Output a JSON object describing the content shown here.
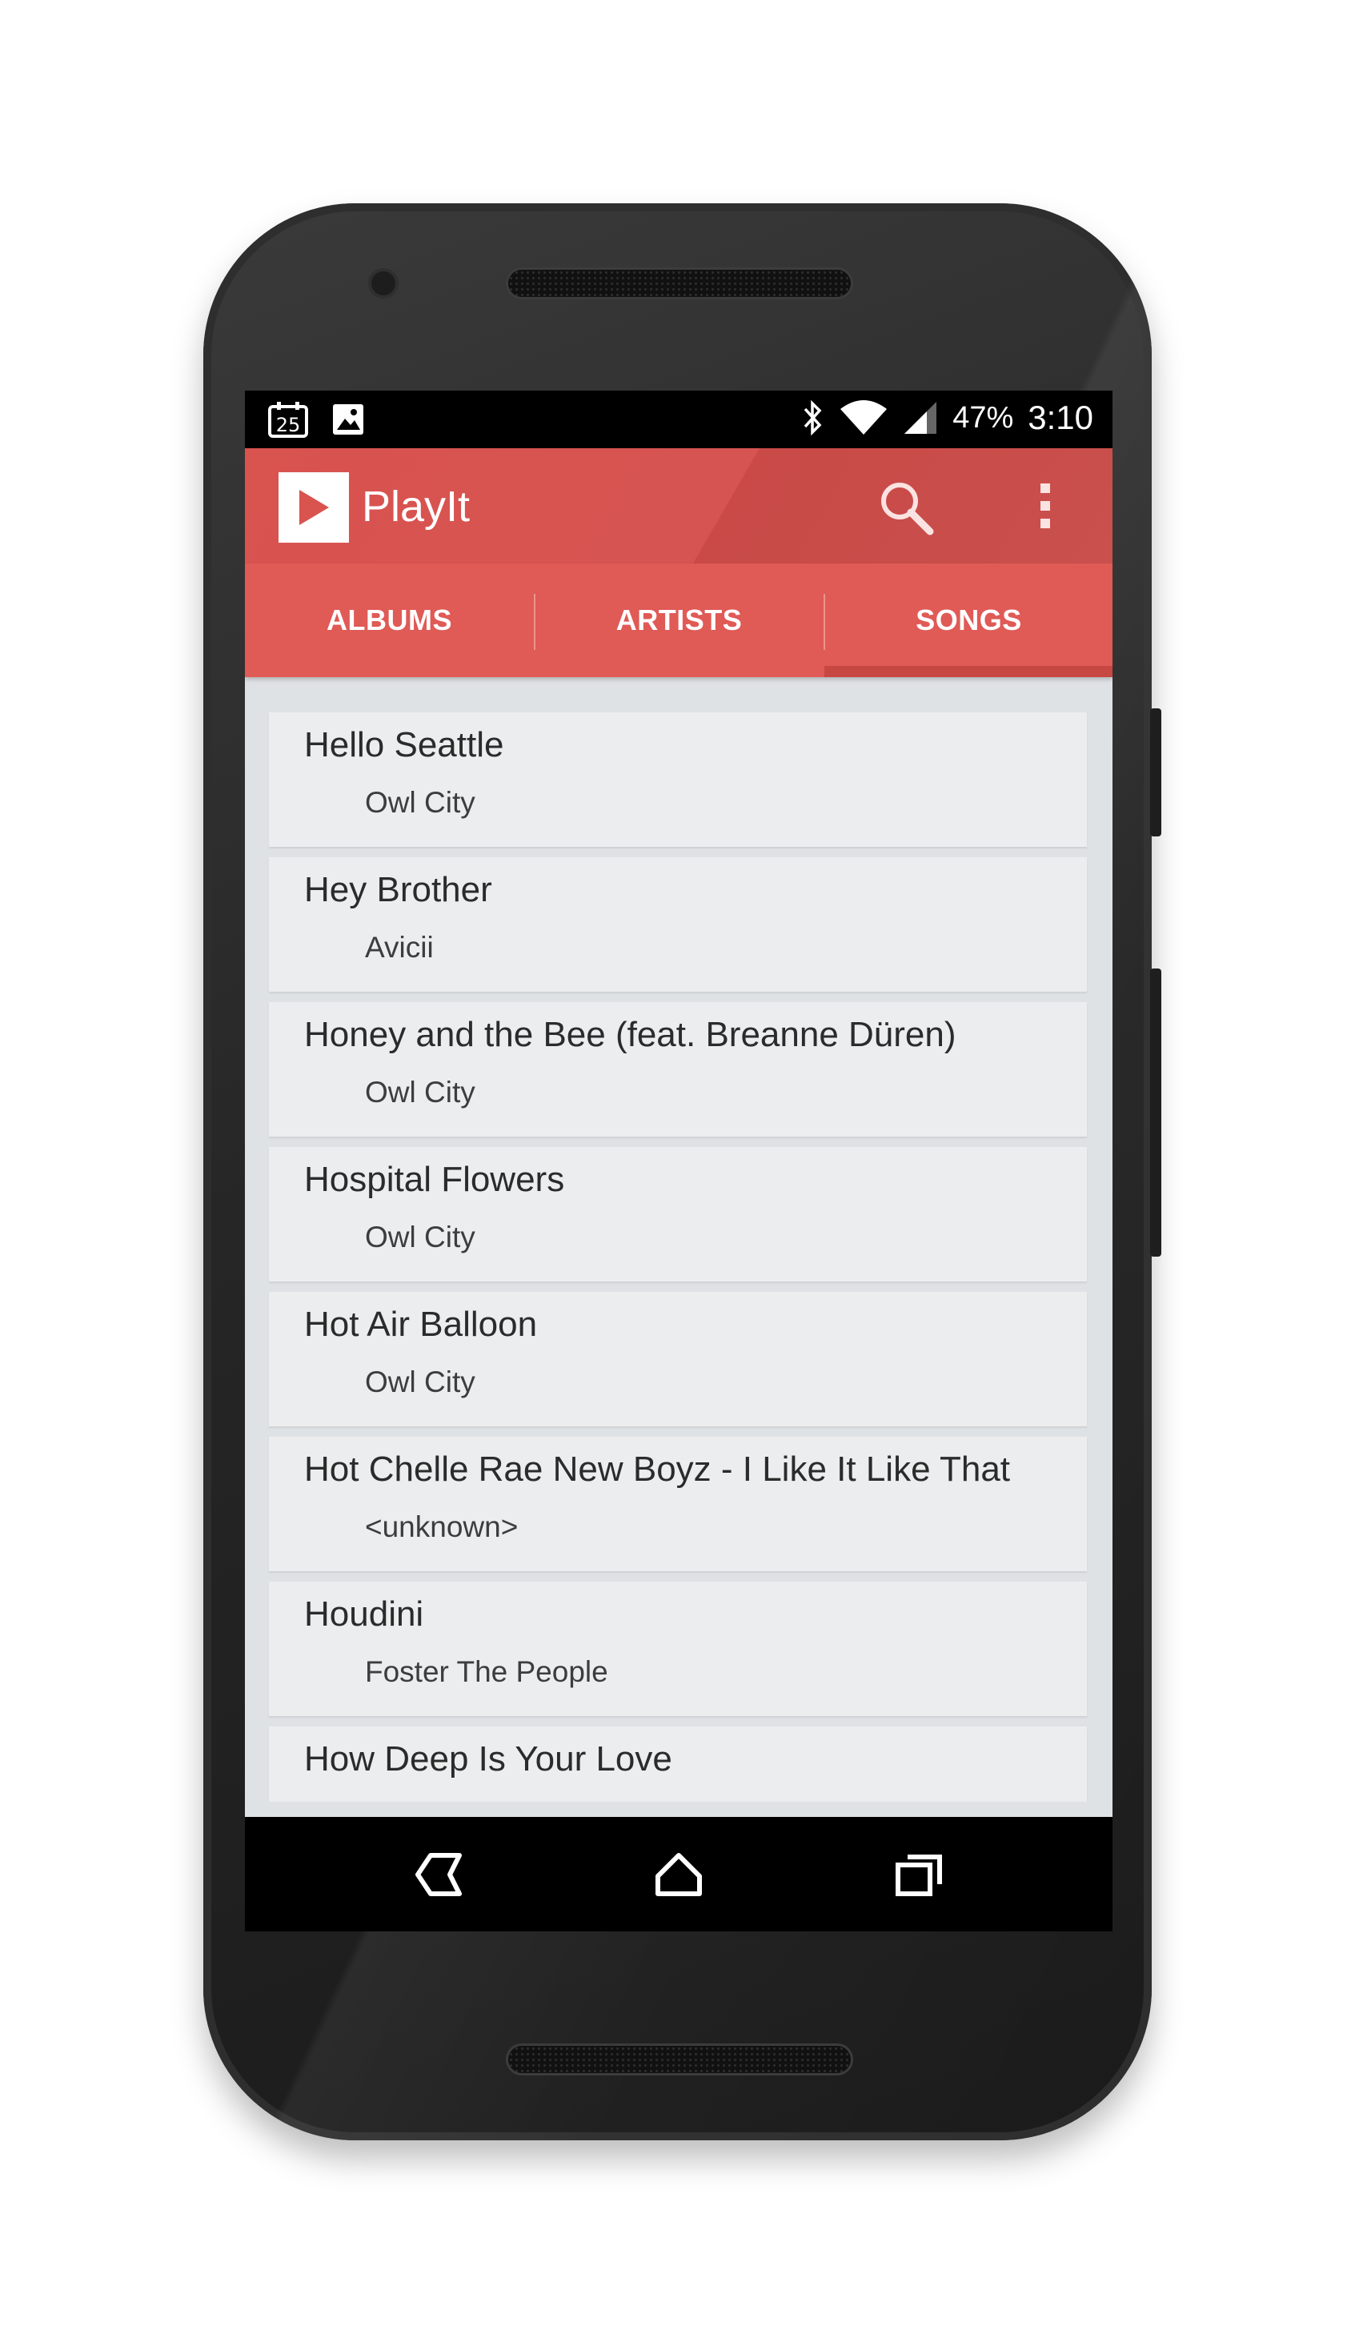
{
  "status_bar": {
    "calendar_day": "25",
    "battery": "47%",
    "time": "3:10",
    "icons": [
      "calendar-icon",
      "image-icon",
      "bluetooth-icon",
      "wifi-icon",
      "signal-icon"
    ]
  },
  "app_bar": {
    "title": "PlayIt",
    "logo_icon": "play-icon",
    "actions": [
      "search-icon",
      "more-vert-icon"
    ],
    "color": "#d9534f"
  },
  "tabs": [
    {
      "label": "ALBUMS",
      "selected": false
    },
    {
      "label": "ARTISTS",
      "selected": false
    },
    {
      "label": "SONGS",
      "selected": true
    }
  ],
  "songs": [
    {
      "title": "Hello Seattle",
      "artist": "Owl City"
    },
    {
      "title": "Hey Brother",
      "artist": "Avicii"
    },
    {
      "title": "Honey and the Bee (feat. Breanne Düren)",
      "artist": "Owl City"
    },
    {
      "title": "Hospital Flowers",
      "artist": "Owl City"
    },
    {
      "title": "Hot Air Balloon",
      "artist": "Owl City"
    },
    {
      "title": "Hot Chelle Rae New Boyz - I Like It Like That",
      "artist": "<unknown>"
    },
    {
      "title": "Houdini",
      "artist": "Foster The People"
    },
    {
      "title": "How Deep Is Your Love",
      "artist": ""
    }
  ],
  "nav_bar": [
    "back-icon",
    "home-icon",
    "recents-icon"
  ]
}
